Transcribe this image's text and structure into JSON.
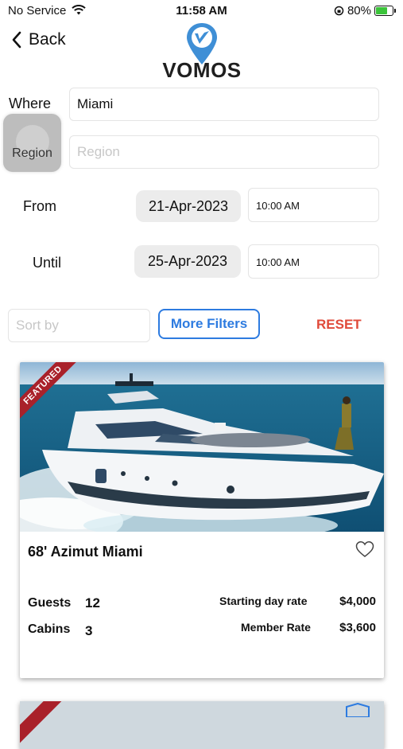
{
  "status_bar": {
    "carrier": "No Service",
    "time": "11:58 AM",
    "battery_percent": "80%",
    "battery_level": 0.8
  },
  "header": {
    "back_label": "Back",
    "logo_text": "VOMOS"
  },
  "search": {
    "where_label": "Where",
    "where_value": "Miami",
    "region_button_label": "Region",
    "region_placeholder": "Region",
    "from_label": "From",
    "from_date": "21-Apr-2023",
    "from_time": "10:00 AM",
    "until_label": "Until",
    "until_date": "25-Apr-2023",
    "until_time": "10:00 AM",
    "sort_placeholder": "Sort by",
    "more_filters_label": "More Filters",
    "reset_label": "RESET"
  },
  "listings": [
    {
      "badge": "FEATURED",
      "title": "68' Azimut Miami",
      "guests_label": "Guests",
      "guests": "12",
      "cabins_label": "Cabins",
      "cabins": "3",
      "day_rate_label": "Starting day rate",
      "day_rate": "$4,000",
      "member_rate_label": "Member Rate",
      "member_rate": "$3,600",
      "favorited": false
    }
  ],
  "colors": {
    "accent_blue": "#2d7be0",
    "reset_red": "#e04a3a",
    "ribbon_red": "#a9212a"
  }
}
